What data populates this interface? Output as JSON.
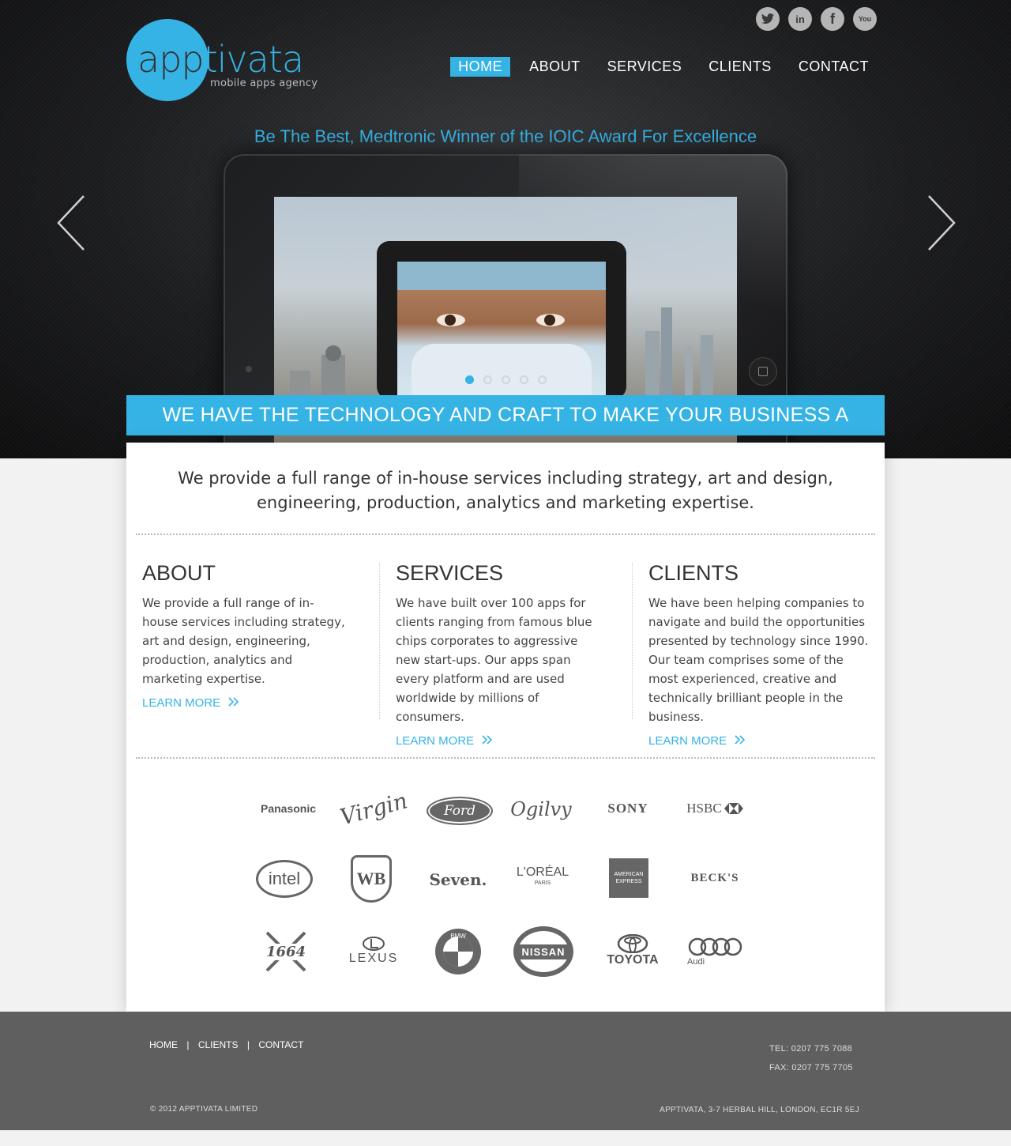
{
  "brand": {
    "logo_app": "app",
    "logo_tivata": "tivata",
    "tagline": "mobile apps agency",
    "accent": "#36b3e5"
  },
  "social": [
    {
      "icon": "twitter-icon",
      "glyph": "t"
    },
    {
      "icon": "linkedin-icon",
      "glyph": "in"
    },
    {
      "icon": "facebook-icon",
      "glyph": "f"
    },
    {
      "icon": "youtube-icon",
      "glyph": "You"
    }
  ],
  "nav": {
    "home": "HOME",
    "about": "ABOUT",
    "services": "SERVICES",
    "clients": "CLIENTS",
    "contact": "CONTACT",
    "active": "home"
  },
  "hero": {
    "award": "Be The Best, Medtronic Winner of the IOIC Award For Excellence",
    "slides_total": 5,
    "slide_active": 1,
    "banner": "WE HAVE THE TECHNOLOGY AND CRAFT TO MAKE YOUR BUSINESS A WINNER"
  },
  "intro": "We provide a full range of in-house services including strategy, art and design, engineering, production, analytics and marketing expertise.",
  "columns": {
    "about": {
      "title": "ABOUT",
      "text": "We provide a full range of in-house services including strategy, art and design, engineering, production, analytics and marketing expertise.",
      "more": "LEARN MORE"
    },
    "services": {
      "title": "SERVICES",
      "text": "We have built over 100 apps for clients ranging from famous blue chips corporates to aggressive new start-ups. Our apps span every platform and are used worldwide by millions of consumers.",
      "more": "LEARN MORE"
    },
    "clients": {
      "title": "CLIENTS",
      "text": "We have been helping companies to navigate and build the opportunities presented by technology since 1990. Our team comprises some of the most experienced, creative and technically brilliant people in the business.",
      "more": "LEARN MORE"
    }
  },
  "client_logos": {
    "panasonic": "Panasonic",
    "virgin": "Virgin",
    "ford": "Ford",
    "ogilvy": "Ogilvy",
    "sony": "SONY",
    "hsbc": "HSBC",
    "intel": "intel",
    "wb": "WB",
    "seven": "Seven.",
    "loreal": "L'ORÉAL",
    "loreal_sub": "PARIS",
    "amex_1": "AMERICAN",
    "amex_2": "EXPRESS",
    "becks": "BECK'S",
    "kronenbourg": "1664",
    "lexus": "LEXUS",
    "bmw": "BMW",
    "nissan": "NISSAN",
    "toyota": "TOYOTA",
    "audi": "Audi"
  },
  "footer": {
    "nav": {
      "home": "HOME",
      "clients": "CLIENTS",
      "contact": "CONTACT",
      "sep": "|"
    },
    "tel": "TEL: 0207 775 7088",
    "fax": "FAX: 0207 775 7705",
    "copyright": "© 2012 APPTIVATA LIMITED",
    "address": "APPTIVATA, 3-7 HERBAL HILL, LONDON, EC1R 5EJ"
  }
}
